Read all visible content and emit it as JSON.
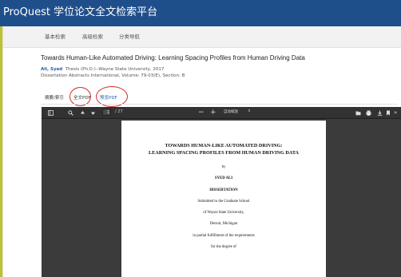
{
  "app": {
    "title": "ProQuest 学位论文全文检索平台"
  },
  "nav": {
    "items": [
      "基本检索",
      "高级检索",
      "分类导航"
    ]
  },
  "document": {
    "title": "Towards Human-Like Automated Driving: Learning Spacing Profiles from Human Driving Data",
    "author": "Ali, Syed",
    "source": "Thesis (Ph.D.)--Wayne State University, 2017",
    "abstracts": "Dissertation Abstracts International, Volume: 79-03(E), Section: B"
  },
  "tabs": {
    "abstract": "摘要/索引",
    "fulltext": "全文PDF",
    "preview": "预览PDF"
  },
  "viewer": {
    "page_current": "1",
    "page_total": "/ 27",
    "zoom": "自动缩放",
    "page_lines": [
      "TOWARDS HUMAN-LIKE AUTOMATED DRIVING:",
      "LEARNING SPACING PROFILES FROM HUMAN DRIVING DATA",
      "by",
      "SYED ALI",
      "DISSERTATION",
      "Submitted to the Graduate School",
      "of Wayne State University,",
      "Detroit, Michigan",
      "in partial fulfillment of the requirements",
      "for the degree of"
    ]
  },
  "colors": {
    "header": "#1f4f8b",
    "link": "#1f5fa8",
    "highlight": "#d42a2a"
  }
}
